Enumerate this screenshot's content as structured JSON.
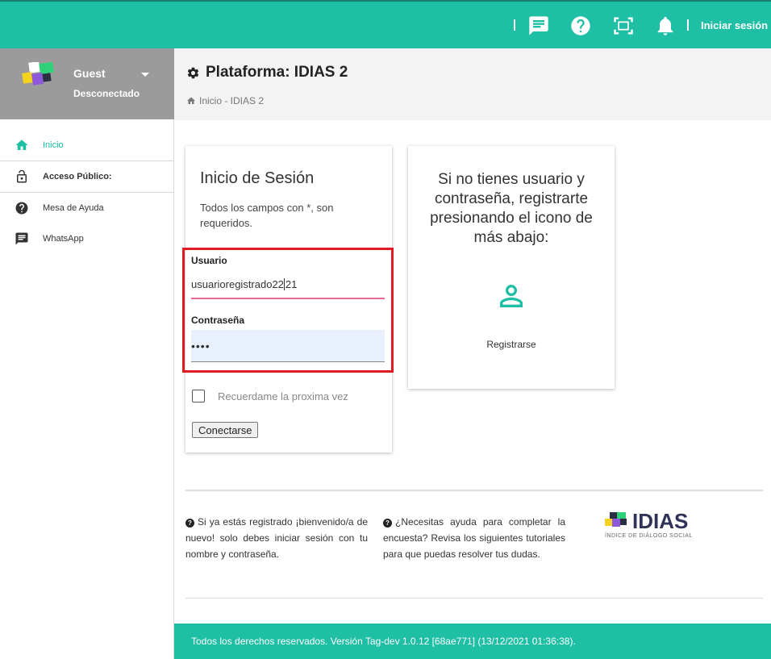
{
  "topbar": {
    "accent_color": "#1ebfa5",
    "icons": [
      "chat-icon",
      "help-icon",
      "fullscreen-icon",
      "bell-icon"
    ],
    "login_label": "Iniciar sesión"
  },
  "sidebar": {
    "user": {
      "name": "Guest",
      "status": "Desconectado"
    },
    "items": [
      {
        "label": "Inicio",
        "icon": "home-icon"
      },
      {
        "label": "Acceso Público:",
        "icon": "lock-icon"
      },
      {
        "label": "Mesa de Ayuda",
        "icon": "help-icon"
      },
      {
        "label": "WhatsApp",
        "icon": "chat-icon"
      }
    ]
  },
  "header": {
    "title": "Plataforma: IDIAS 2",
    "breadcrumb": "Inicio - IDIAS 2"
  },
  "login": {
    "title": "Inicio de Sesión",
    "note": "Todos los campos con *, son requeridos.",
    "username_label": "Usuario",
    "username_value_before_caret": "usuarioregistrado22",
    "username_value_after_caret": "21",
    "password_label": "Contraseña",
    "password_value": "••••",
    "remember_label": "Recuerdame la proxima vez",
    "submit_label": "Conectarse"
  },
  "register": {
    "text": "Si no tienes usuario y contraseña, registrarte presionando el icono de más abajo:",
    "label": "Registrarse"
  },
  "info": {
    "left": "Si ya estás registrado ¡bienvenido/a de nuevo! solo debes iniciar sesión con tu nombre y contraseña.",
    "right": "¿Necesitas ayuda para completar la encuesta? Revisa los siguientes tutoriales para que puedas resolver tus dudas."
  },
  "brand": {
    "name": "IDIAS",
    "subtitle": "ÍNDICE DE DIÁLOGO SOCIAL"
  },
  "footer": {
    "text": "Todos los derechos reservados. Versión Tag-dev 1.0.12 [68ae771] (13/12/2021 01:36:38)."
  }
}
